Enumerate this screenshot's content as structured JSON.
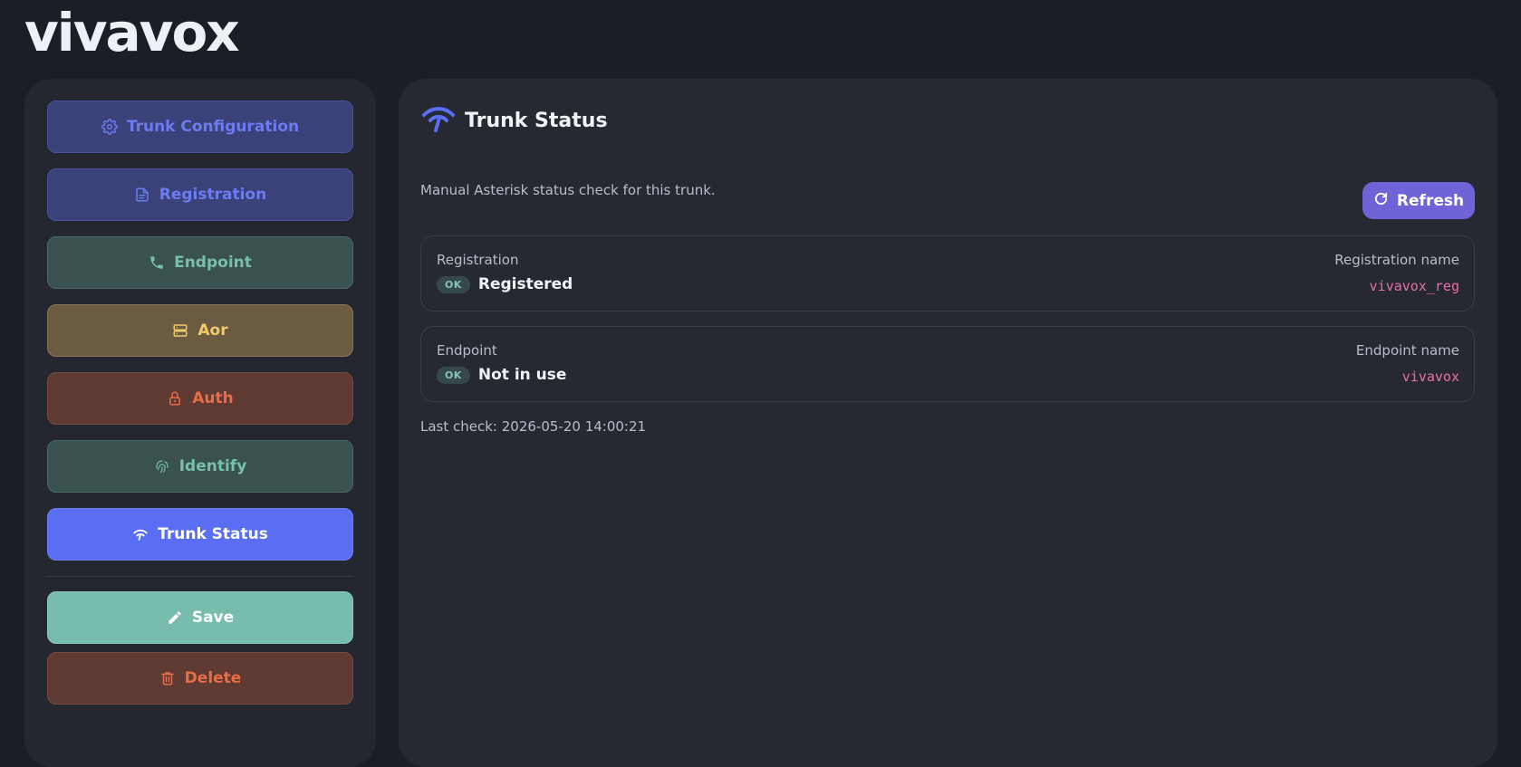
{
  "app": {
    "logo": "vivavox"
  },
  "sidebar": {
    "items": [
      {
        "label": "Trunk Configuration",
        "icon": "gear-icon"
      },
      {
        "label": "Registration",
        "icon": "document-icon"
      },
      {
        "label": "Endpoint",
        "icon": "phone-icon"
      },
      {
        "label": "Aor",
        "icon": "server-icon"
      },
      {
        "label": "Auth",
        "icon": "lock-icon"
      },
      {
        "label": "Identify",
        "icon": "fingerprint-icon"
      },
      {
        "label": "Trunk Status",
        "icon": "wifi-icon",
        "active": true
      }
    ],
    "actions": {
      "save_label": "Save",
      "delete_label": "Delete"
    }
  },
  "panel": {
    "title": "Trunk Status",
    "description": "Manual Asterisk status check for this trunk.",
    "refresh_label": "Refresh",
    "registration": {
      "label": "Registration",
      "badge": "OK",
      "state": "Registered",
      "name_label": "Registration name",
      "name_value": "vivavox_reg"
    },
    "endpoint": {
      "label": "Endpoint",
      "badge": "OK",
      "state": "Not in use",
      "name_label": "Endpoint name",
      "name_value": "vivavox"
    },
    "last_check": "Last check: 2026-05-20 14:00:21"
  },
  "colors": {
    "background": "#1c1e27",
    "panel": "#262932",
    "accent_blue": "#5a6ef3",
    "refresh_purple": "#6e64d8",
    "ok_green": "#84c3b3",
    "mono_pink": "#e86fa6"
  }
}
